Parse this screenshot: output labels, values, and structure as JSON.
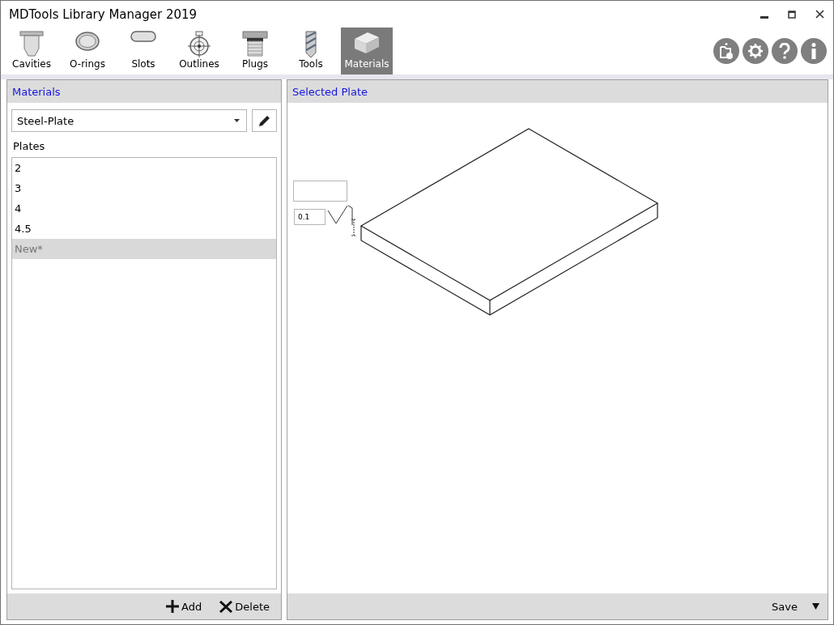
{
  "window": {
    "title": "MDTools Library Manager 2019"
  },
  "tabs": [
    {
      "label": "Cavities",
      "kind": "cavity",
      "selected": false
    },
    {
      "label": "O-rings",
      "kind": "oring",
      "selected": false
    },
    {
      "label": "Slots",
      "kind": "slot",
      "selected": false
    },
    {
      "label": "Outlines",
      "kind": "outline",
      "selected": false
    },
    {
      "label": "Plugs",
      "kind": "plug",
      "selected": false
    },
    {
      "label": "Tools",
      "kind": "tool",
      "selected": false
    },
    {
      "label": "Materials",
      "kind": "material",
      "selected": true
    }
  ],
  "materials_panel": {
    "title": "Materials",
    "material": "Steel-Plate",
    "list_label": "Plates",
    "plates": [
      {
        "label": "2",
        "selected": false
      },
      {
        "label": "3",
        "selected": false
      },
      {
        "label": "4",
        "selected": false
      },
      {
        "label": "4.5",
        "selected": false
      },
      {
        "label": "New*",
        "selected": true
      }
    ],
    "buttons": [
      {
        "label": "Add",
        "kind": "add"
      },
      {
        "label": "Delete",
        "kind": "delete"
      }
    ]
  },
  "plate_panel": {
    "title": "Selected Plate",
    "tolerance": "0.1",
    "save": "Save"
  }
}
